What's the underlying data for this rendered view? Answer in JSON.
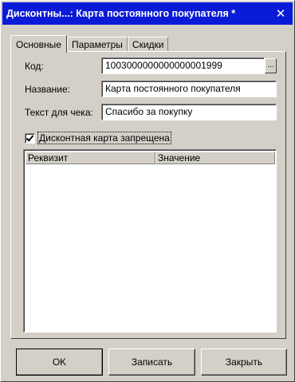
{
  "window": {
    "title": "Дисконтны...: Карта постоянного покупателя *",
    "close_symbol": "✕"
  },
  "tabs": [
    {
      "label": "Основные",
      "active": true
    },
    {
      "label": "Параметры",
      "active": false
    },
    {
      "label": "Скидки",
      "active": false
    }
  ],
  "form": {
    "code_label": "Код:",
    "code_value": "1003000000000000001999",
    "code_select_button": "...",
    "name_label": "Название:",
    "name_value": "Карта постоянного покупателя",
    "receipt_label": "Текст для чека:",
    "receipt_value": "Спасибо за покупку",
    "blocked_label": "Дисконтная карта запрещена",
    "blocked_checked": true
  },
  "table": {
    "columns": [
      "Реквизит",
      "Значение"
    ],
    "rows": []
  },
  "buttons": {
    "ok": "OK",
    "save": "Записать",
    "close": "Закрыть"
  }
}
